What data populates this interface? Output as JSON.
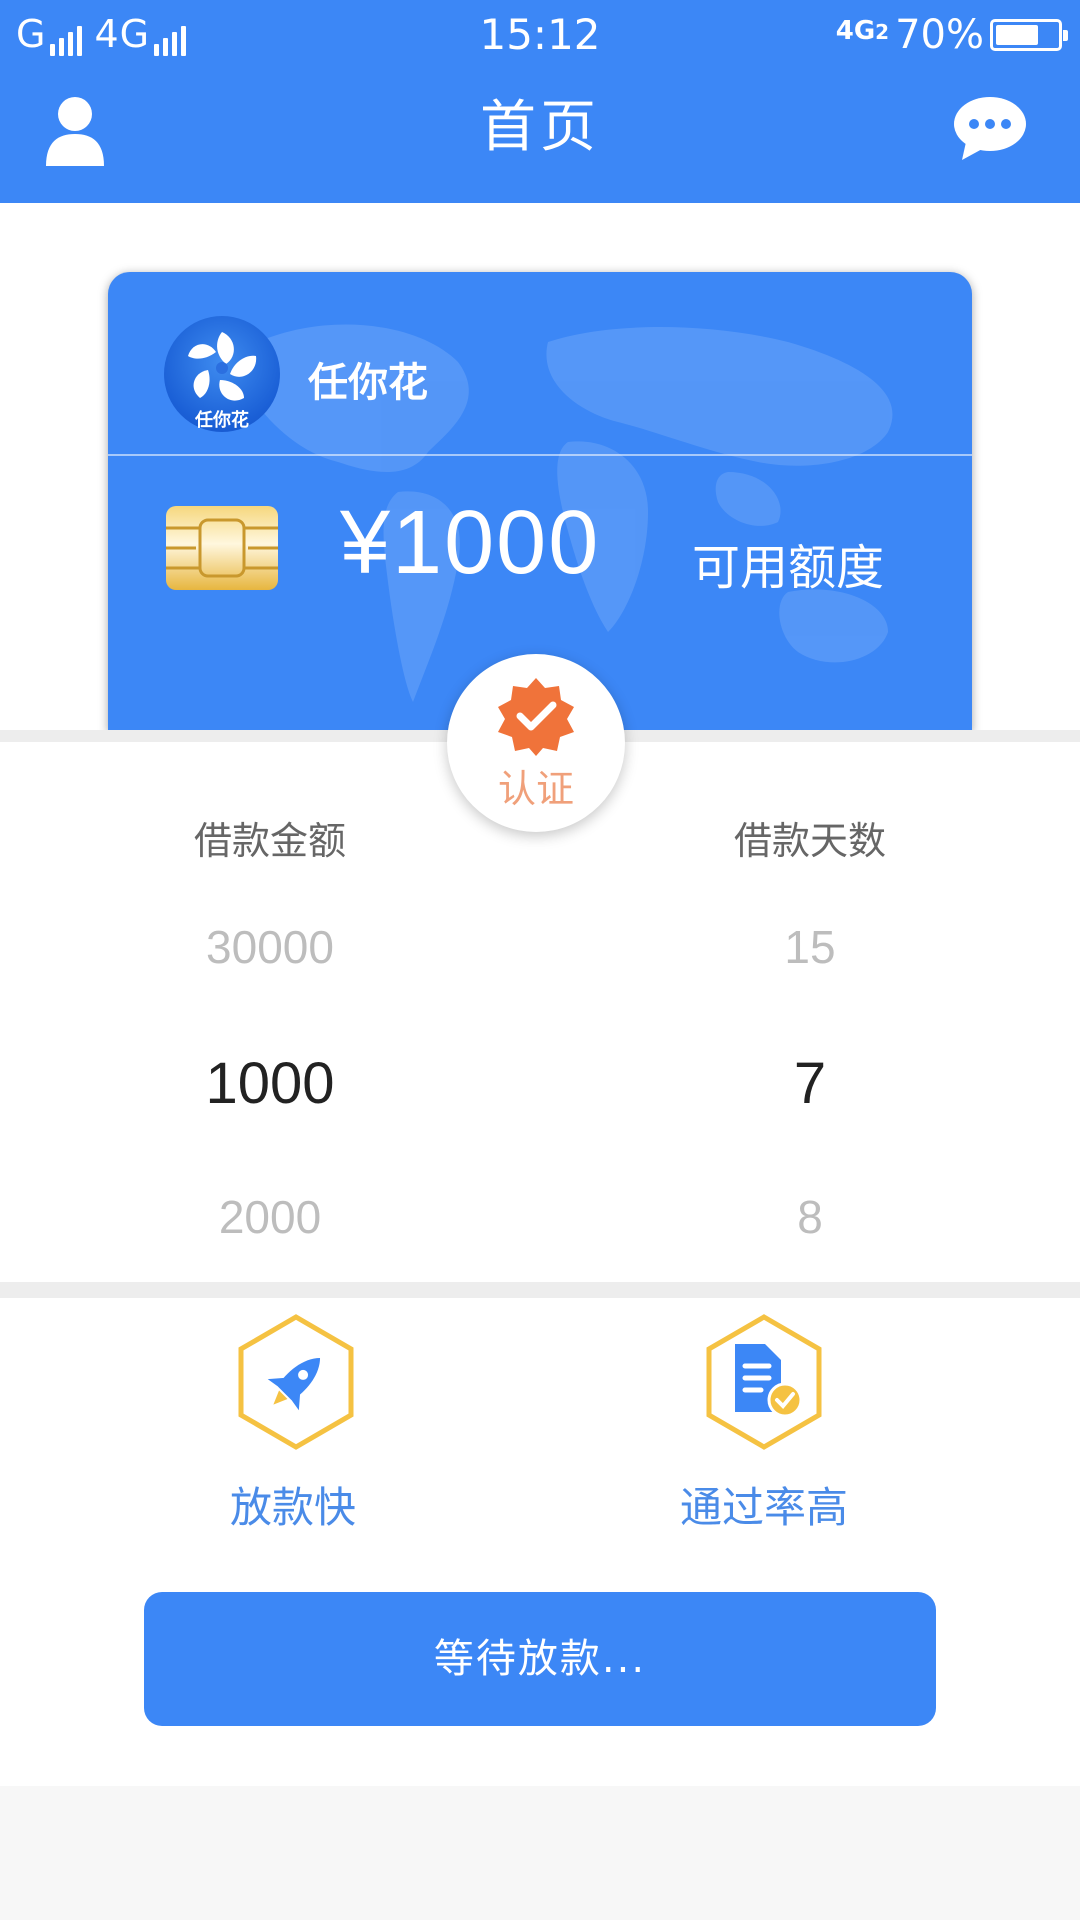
{
  "status_bar": {
    "signal_left": "G",
    "signal_right": "4G",
    "time": "15:12",
    "net_type": "4G",
    "net_sim": "2",
    "battery": "70%"
  },
  "header": {
    "title": "首页",
    "left_icon": "user-icon",
    "right_icon": "chat-bubble-icon"
  },
  "card": {
    "brand_logo_text": "任你花",
    "brand_name": "任你花",
    "amount": "¥1000",
    "amount_label": "可用额度"
  },
  "badge": {
    "label": "认证",
    "icon": "verified-check-icon"
  },
  "picker": {
    "amount": {
      "title": "借款金额",
      "above": "30000",
      "selected": "1000",
      "below": "2000"
    },
    "days": {
      "title": "借款天数",
      "above": "15",
      "selected": "7",
      "below": "8"
    }
  },
  "features": [
    {
      "label": "放款快",
      "icon": "rocket-icon"
    },
    {
      "label": "通过率高",
      "icon": "document-check-icon"
    }
  ],
  "action_button": {
    "label": "等待放款..."
  },
  "colors": {
    "primary": "#3c87f6",
    "feature_text": "#4a8be8",
    "badge_orange": "#f0733a",
    "hex_border": "#f5c242"
  }
}
